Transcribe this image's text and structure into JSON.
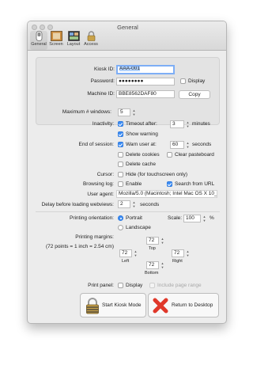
{
  "window": {
    "title": "General"
  },
  "toolbar": {
    "items": [
      {
        "label": "General",
        "icon": "general-switch-icon"
      },
      {
        "label": "Screen",
        "icon": "screen-icon"
      },
      {
        "label": "Layout",
        "icon": "layout-icon"
      },
      {
        "label": "Access",
        "icon": "padlock-icon"
      }
    ]
  },
  "kiosk": {
    "kiosk_id_label": "Kiosk ID:",
    "kiosk_id_value": "AAA-001",
    "password_label": "Password:",
    "password_value": "●●●●●●●●",
    "display_label": "Display",
    "machine_id_label": "Machine ID:",
    "machine_id_value": "BBE8562DAF80",
    "copy_label": "Copy"
  },
  "settings": {
    "max_windows_label": "Maximum # windows:",
    "max_windows_value": "5",
    "inactivity_label": "Inactivity:",
    "timeout_after_label": "Timeout after:",
    "timeout_value": "3",
    "minutes_label": "minutes",
    "show_warning_label": "Show warning",
    "end_session_label": "End of session:",
    "warn_user_label": "Warn user at:",
    "warn_value": "60",
    "seconds_label": "seconds",
    "delete_cookies_label": "Delete cookies",
    "clear_pasteboard_label": "Clear pasteboard",
    "delete_cache_label": "Delete cache",
    "cursor_label": "Cursor:",
    "hide_cursor_label": "Hide (for touchscreen only)",
    "browsing_log_label": "Browsing log:",
    "enable_label": "Enable",
    "search_from_url_label": "Search from URL",
    "user_agent_label": "User agent:",
    "user_agent_value": "Mozilla/5.0 (Macintosh; Intel Mac OS X 10_1",
    "delay_label": "Delay before loading webviews:",
    "delay_value": "2",
    "delay_unit": "seconds"
  },
  "printing": {
    "orientation_label": "Printing orientation:",
    "portrait_label": "Portrait",
    "landscape_label": "Landscape",
    "scale_label": "Scale:",
    "scale_value": "100",
    "percent_label": "%",
    "margins_label": "Printing margins:",
    "margins_note": "(72 points = 1 inch = 2.54 cm)",
    "top_value": "72",
    "top_label": "Top",
    "left_value": "72",
    "left_label": "Left",
    "right_value": "72",
    "right_label": "Right",
    "bottom_value": "72",
    "bottom_label": "Bottom",
    "print_panel_label": "Print panel:",
    "display_label": "Display",
    "include_page_range_label": "Include page range"
  },
  "actions": {
    "start_label": "Start Kiosk Mode",
    "return_label": "Return to Desktop"
  },
  "colors": {
    "accent": "#3d8df5",
    "return_icon": "#e0382a"
  }
}
